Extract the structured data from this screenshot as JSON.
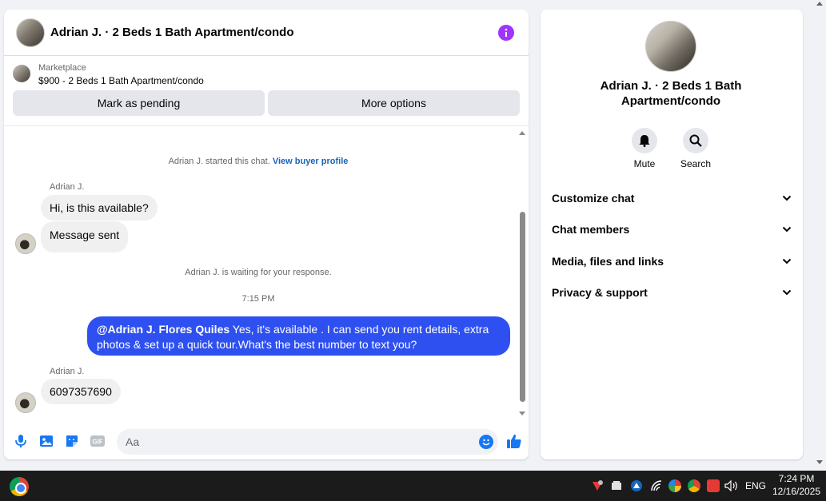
{
  "chat": {
    "title": "Adrian J. · 2 Beds 1 Bath Apartment/condo",
    "marketplace_label": "Marketplace",
    "listing": "$900 - 2 Beds 1 Bath Apartment/condo",
    "mark_pending": "Mark as pending",
    "more_options": "More options"
  },
  "messages": {
    "started": "Adrian J. started this chat.",
    "view_profile": "View buyer profile",
    "sender1": "Adrian J.",
    "msg1": "Hi, is this available?",
    "msg2": "Message sent",
    "waiting": "Adrian J. is waiting for your response.",
    "time": "7:15 PM",
    "out_mention": "@Adrian J. Flores Quiles",
    "out_text": " Yes, it's available .  I can send you rent details, extra photos & set up a quick tour.What's the best number to text you?",
    "sender2": "Adrian J.",
    "msg3": "6097357690"
  },
  "composer": {
    "placeholder": "Aa",
    "icons": [
      "microphone-icon",
      "photo-icon",
      "sticker-icon",
      "gif-icon",
      "emoji-icon",
      "thumbs-up-icon"
    ]
  },
  "info_panel": {
    "title": "Adrian J. · 2 Beds 1 Bath Apartment/condo",
    "mute": "Mute",
    "search": "Search",
    "sections": [
      "Customize chat",
      "Chat members",
      "Media, files and links",
      "Privacy & support"
    ]
  },
  "taskbar": {
    "language": "ENG",
    "time": "7:24 PM",
    "date": "12/16/2025"
  },
  "colors": {
    "accent": "#2e50f0",
    "info_purple": "#a033ff",
    "messenger_blue": "#1877f2"
  }
}
